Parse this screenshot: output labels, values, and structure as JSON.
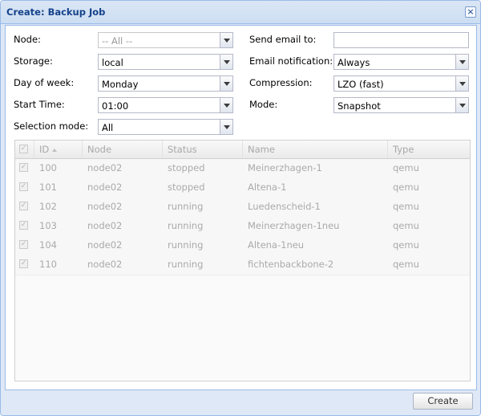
{
  "window": {
    "title": "Create: Backup Job",
    "close_symbol": "×"
  },
  "form": {
    "node": {
      "label": "Node:",
      "value": "-- All --"
    },
    "storage": {
      "label": "Storage:",
      "value": "local"
    },
    "day_of_week": {
      "label": "Day of week:",
      "value": "Monday"
    },
    "start_time": {
      "label": "Start Time:",
      "value": "01:00"
    },
    "selection_mode": {
      "label": "Selection mode:",
      "value": "All"
    },
    "send_email": {
      "label": "Send email to:",
      "value": ""
    },
    "email_notification": {
      "label": "Email notification:",
      "value": "Always"
    },
    "compression": {
      "label": "Compression:",
      "value": "LZO (fast)"
    },
    "mode": {
      "label": "Mode:",
      "value": "Snapshot"
    }
  },
  "grid": {
    "columns": [
      "ID",
      "Node",
      "Status",
      "Name",
      "Type"
    ],
    "sort_column": "ID",
    "sort_direction": "ascending",
    "rows": [
      {
        "id": "100",
        "node": "node02",
        "status": "stopped",
        "name": "Meinerzhagen-1",
        "type": "qemu"
      },
      {
        "id": "101",
        "node": "node02",
        "status": "stopped",
        "name": "Altena-1",
        "type": "qemu"
      },
      {
        "id": "102",
        "node": "node02",
        "status": "running",
        "name": "Luedenscheid-1",
        "type": "qemu"
      },
      {
        "id": "103",
        "node": "node02",
        "status": "running",
        "name": "Meinerzhagen-1neu",
        "type": "qemu"
      },
      {
        "id": "104",
        "node": "node02",
        "status": "running",
        "name": "Altena-1neu",
        "type": "qemu"
      },
      {
        "id": "110",
        "node": "node02",
        "status": "running",
        "name": "fichtenbackbone-2",
        "type": "qemu"
      }
    ]
  },
  "footer": {
    "create_label": "Create"
  },
  "colors": {
    "title_text": "#15428b",
    "window_bg": "#dfe8f6",
    "border": "#99bbe8",
    "disabled_text": "#aaaaaa"
  }
}
